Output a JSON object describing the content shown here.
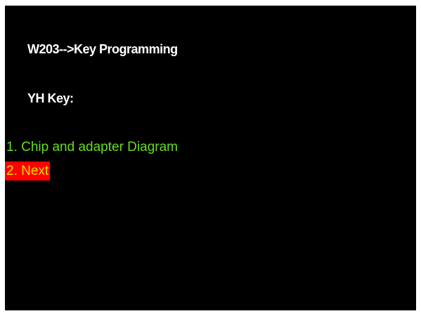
{
  "screen": {
    "title": "W203-->Key Programming",
    "subtitle": "YH Key:"
  },
  "menu": {
    "items": [
      {
        "label": "1. Chip and adapter Diagram",
        "selected": false,
        "color": "#66dd22"
      },
      {
        "label": "2. Next",
        "selected": true,
        "color": "#ffdd00",
        "highlight": "#ff0000"
      }
    ]
  },
  "colors": {
    "background": "#000000",
    "heading_text": "#ffffff"
  }
}
